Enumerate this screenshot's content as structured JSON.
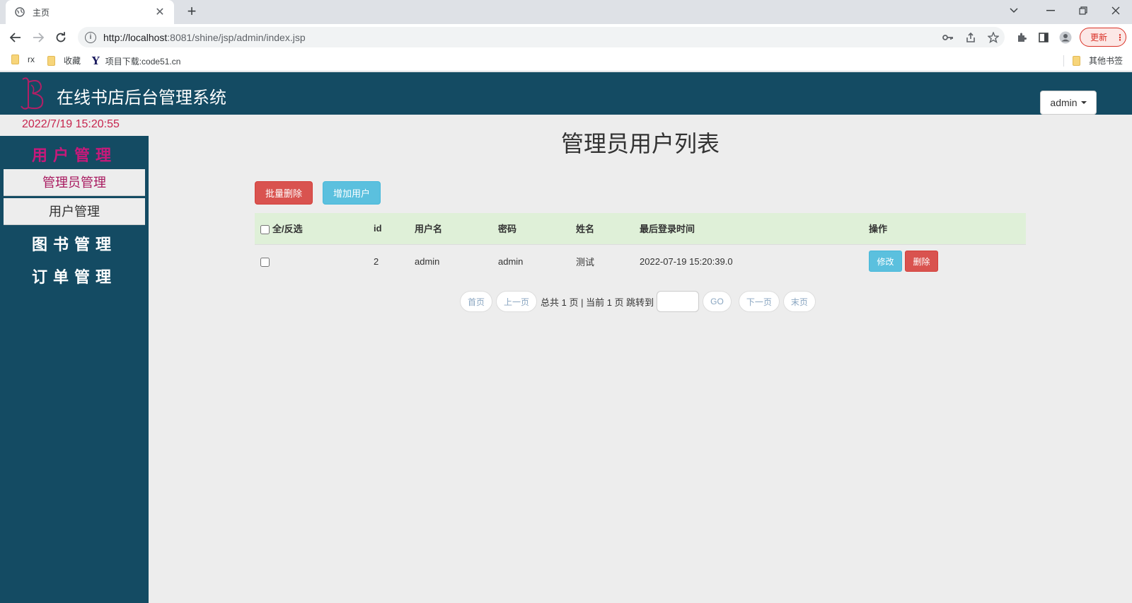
{
  "browser": {
    "tab_title": "主页",
    "tab_close": "✕",
    "new_tab": "+",
    "url_host": "http://localhost",
    "url_rest": ":8081/shine/jsp/admin/index.jsp",
    "update_label": "更新",
    "bookmarks": [
      {
        "label": "rx"
      },
      {
        "label": "收藏"
      },
      {
        "label": "项目下载:code51.cn"
      }
    ],
    "other_bookmarks": "其他书签"
  },
  "app": {
    "title": "在线书店后台管理系统",
    "user_menu": "admin",
    "clock": "2022/7/19 15:20:55",
    "accent_color": "#144b63"
  },
  "sidebar": {
    "sections": [
      {
        "label": "用户管理"
      },
      {
        "label": "图书管理"
      },
      {
        "label": "订单管理"
      }
    ],
    "items": [
      {
        "label": "管理员管理"
      },
      {
        "label": "用户管理"
      }
    ]
  },
  "main": {
    "page_title": "管理员用户列表",
    "batch_delete": "批量删除",
    "add_user": "增加用户",
    "table": {
      "headers": [
        "全/反选",
        "id",
        "用户名",
        "密码",
        "姓名",
        "最后登录时间",
        "操作"
      ],
      "rows": [
        {
          "id": "2",
          "username": "admin",
          "password": "admin",
          "name": "测试",
          "last_login": "2022-07-19 15:20:39.0",
          "edit": "修改",
          "delete": "删除"
        }
      ]
    },
    "pager": {
      "first": "首页",
      "prev": "上一页",
      "info": "总共 1 页 | 当前 1 页 跳转到",
      "go": "GO",
      "next": "下一页",
      "last": "末页"
    }
  }
}
